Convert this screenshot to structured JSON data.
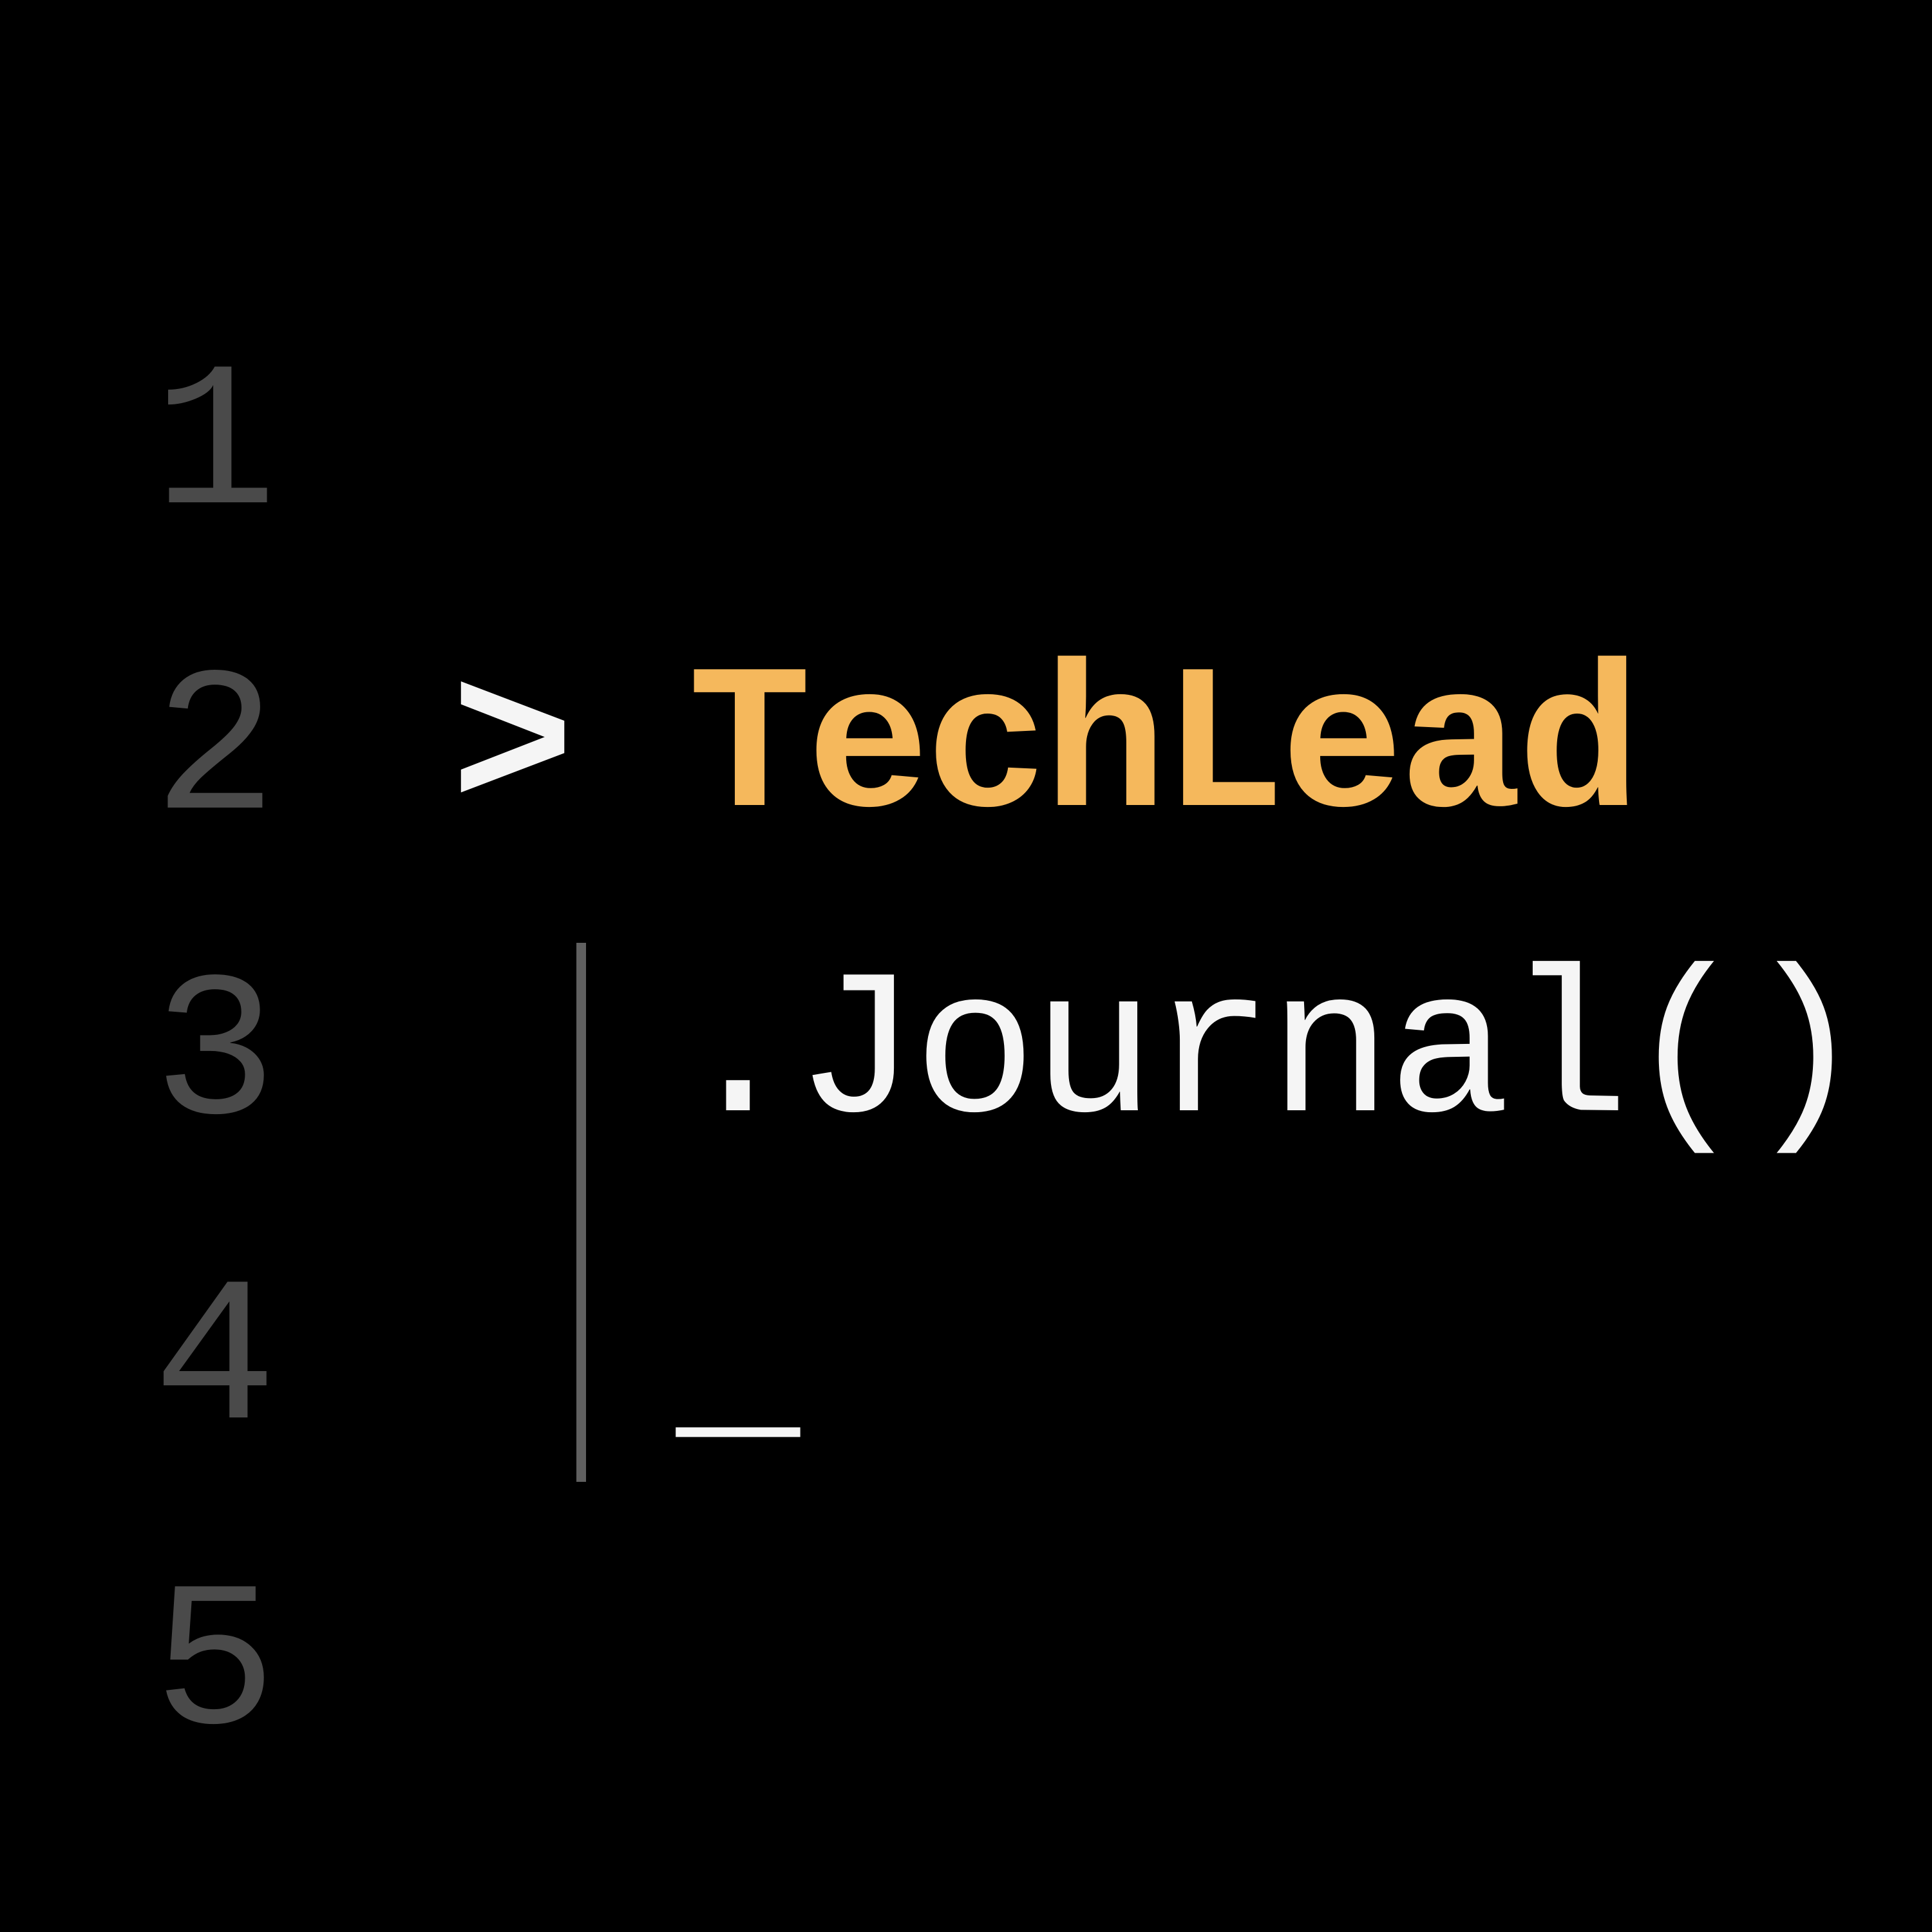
{
  "gutter": {
    "lines": [
      "1",
      "2",
      "3",
      "4",
      "5"
    ]
  },
  "code": {
    "prompt": "> ",
    "keyword": "TechLead",
    "method": ".Journal()",
    "cursor": "_"
  }
}
